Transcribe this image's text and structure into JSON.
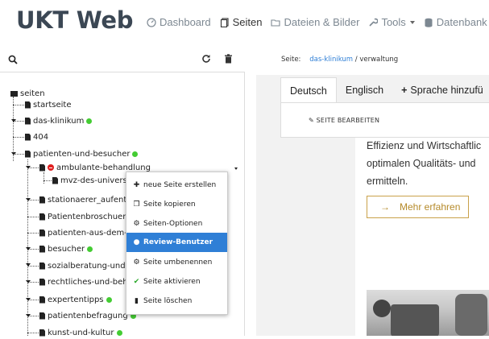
{
  "app": {
    "title": "UKT Web"
  },
  "nav": {
    "dashboard": "Dashboard",
    "pages": "Seiten",
    "files": "Dateien & Bilder",
    "tools": "Tools",
    "database": "Datenbank"
  },
  "tree": {
    "root": "seiten",
    "items": {
      "startseite": "startseite",
      "das_klinikum": "das-klinikum",
      "n404": "404",
      "patienten": "patienten-und-besucher",
      "ambulante": "ambulante-behandlung",
      "mvz": "mvz-des-universit",
      "stationaer": "stationaerer_aufentha",
      "broschueren": "Patientenbroschueren",
      "aus_dem": "patienten-aus-dem-au",
      "besucher": "besucher",
      "sozial": "sozialberatung-und-e",
      "rechtliches": "rechtliches-und-beha",
      "expertentipps": "expertentipps",
      "befragung": "patientenbefragung",
      "kunst": "kunst-und-kultur"
    }
  },
  "context_menu": {
    "new_page": "neue Seite erstellen",
    "copy_page": "Seite kopieren",
    "options": "Seiten-Optionen",
    "review": "Review-Benutzer",
    "rename": "Seite umbenennen",
    "activate": "Seite aktivieren",
    "delete": "Seite löschen"
  },
  "breadcrumb": {
    "label": "Seite:",
    "link": "das-klinikum",
    "rest": " / verwaltung"
  },
  "tabs": {
    "german": "Deutsch",
    "english": "Englisch",
    "add_language": "Sprache hinzufü"
  },
  "edit_button": "SEITE BEARBEITEN",
  "content": {
    "line1": "Effizienz und Wirtschaftlic",
    "line2": "optimalen Qualitäts- und",
    "line3": "ermitteln.",
    "more_button": "Mehr erfahren",
    "more_arrow": "→"
  },
  "colors": {
    "accent": "#2f7fd6",
    "active_dot": "#44cc33",
    "inactive_dot": "#e02020",
    "gold": "#c9a14a"
  }
}
